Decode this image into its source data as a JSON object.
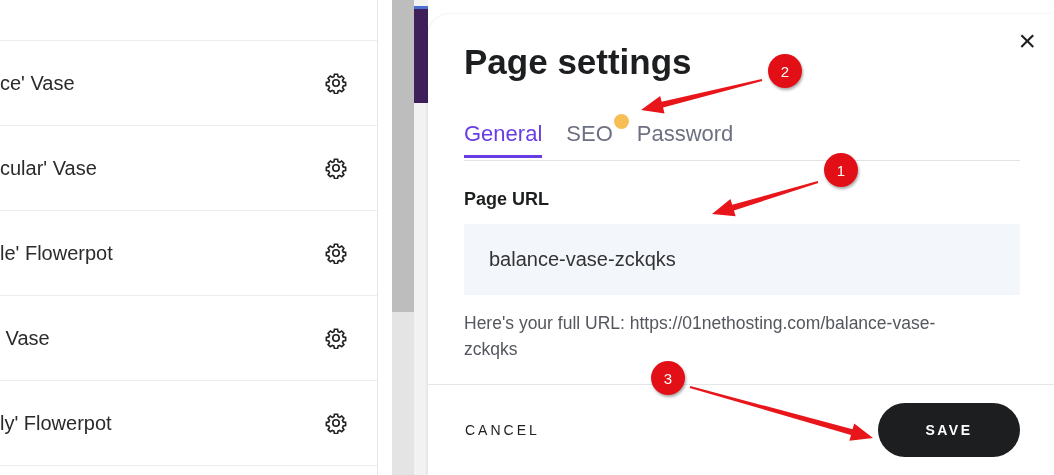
{
  "page_list": {
    "items": [
      {
        "label": "ce' Vase"
      },
      {
        "label": "cular' Vase"
      },
      {
        "label": "le' Flowerpot"
      },
      {
        "label": " Vase"
      },
      {
        "label": "ly' Flowerpot"
      }
    ]
  },
  "dialog": {
    "title": "Page settings",
    "close": "×",
    "tabs": [
      {
        "label": "General",
        "selected": true,
        "dot": false
      },
      {
        "label": "SEO",
        "selected": false,
        "dot": true
      },
      {
        "label": "Password",
        "selected": false,
        "dot": false
      }
    ],
    "field_label": "Page URL",
    "url_value": "balance-vase-zckqks",
    "helper": "Here's your full URL: https://01nethosting.com/balance-vase-zckqks",
    "buttons": [
      {
        "kind": "text",
        "label": "CANCEL"
      },
      {
        "kind": "primary",
        "label": "SAVE"
      }
    ]
  },
  "annotations": [
    {
      "label": "1"
    },
    {
      "label": "2"
    },
    {
      "label": "3"
    }
  ]
}
